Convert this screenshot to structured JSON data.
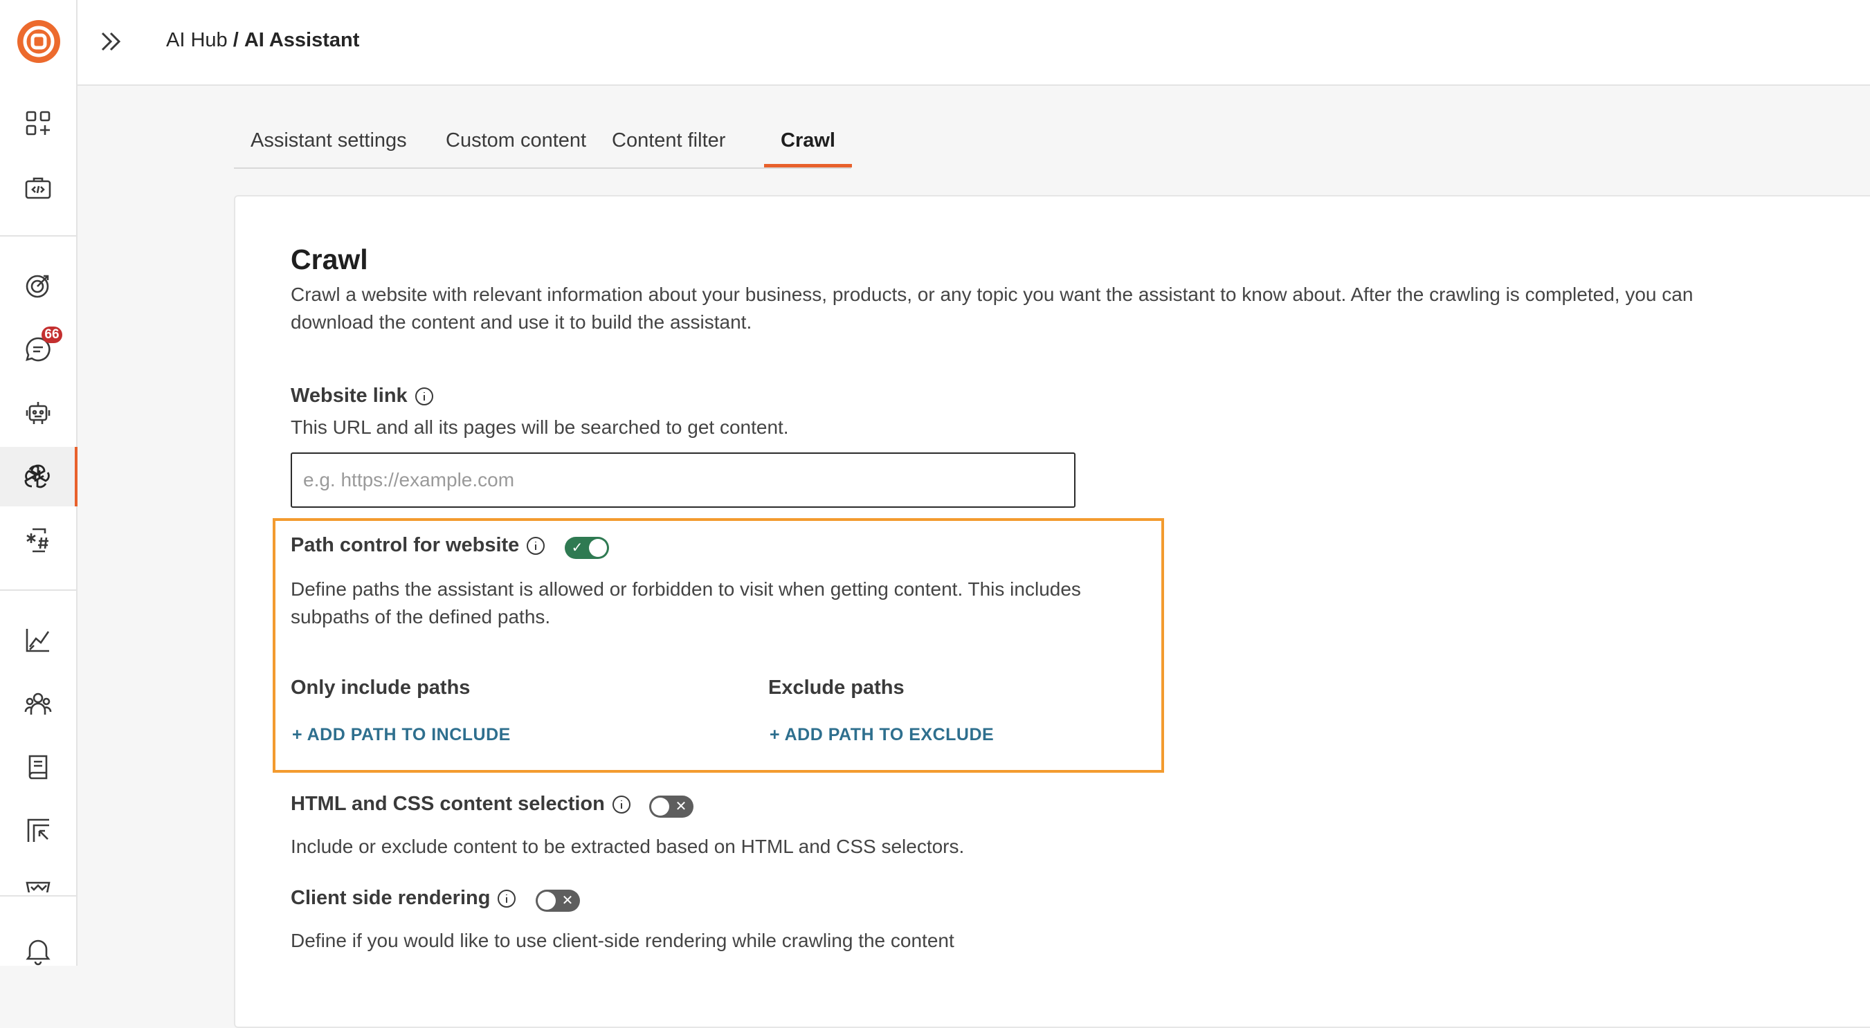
{
  "breadcrumb": {
    "parent": "AI Hub",
    "separator": "/",
    "current": "AI Assistant"
  },
  "sidebar": {
    "badge_count": "66",
    "items": [
      {
        "icon": "apps-add-icon"
      },
      {
        "icon": "toolbox-code-icon"
      },
      {
        "icon": "target-icon"
      },
      {
        "icon": "chat-bubble-icon"
      },
      {
        "icon": "robot-icon"
      },
      {
        "icon": "ai-hub-icon",
        "active": true
      },
      {
        "icon": "asterisk-hash-icon"
      },
      {
        "icon": "chart-line-icon"
      },
      {
        "icon": "users-icon"
      },
      {
        "icon": "book-icon"
      },
      {
        "icon": "board-cursor-icon"
      },
      {
        "icon": "partial-icon"
      },
      {
        "icon": "bell-icon"
      }
    ]
  },
  "tabs": [
    {
      "label": "Assistant settings"
    },
    {
      "label": "Custom content"
    },
    {
      "label": "Content filter"
    },
    {
      "label": "Crawl",
      "active": true
    }
  ],
  "crawl": {
    "title": "Crawl",
    "description_line1": "Crawl a website with relevant information about your business, products, or any topic you want the assistant to know about. After the crawling is completed, you can",
    "description_line2": "download the content and use it to build the assistant.",
    "website_link": {
      "label": "Website link",
      "help": "This URL and all its pages will be searched to get content.",
      "placeholder": "e.g. https://example.com",
      "value": ""
    },
    "path_control": {
      "label": "Path control for website",
      "enabled": true,
      "description_line1": "Define paths the assistant is allowed or forbidden to visit when getting content. This includes",
      "description_line2": "subpaths of the defined paths.",
      "include_label": "Only include paths",
      "include_action": "+ ADD PATH TO INCLUDE",
      "exclude_label": "Exclude paths",
      "exclude_action": "+ ADD PATH TO EXCLUDE"
    },
    "html_css": {
      "label": "HTML and CSS content selection",
      "enabled": false,
      "description": "Include or exclude content to be extracted based on HTML and CSS selectors."
    },
    "client_side": {
      "label": "Client side rendering",
      "enabled": false,
      "description": "Define if you would like to use client-side rendering while crawling the content"
    }
  },
  "colors": {
    "accent": "#e8612c",
    "toggle_on": "#2f7a52",
    "highlight": "#f39b2f",
    "link": "#2e6f8e",
    "badge": "#c42f2f"
  }
}
